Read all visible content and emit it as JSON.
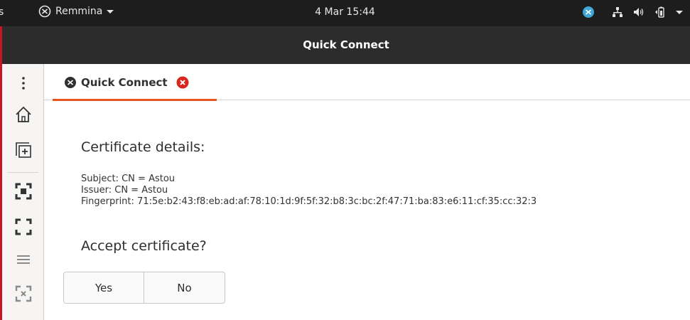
{
  "topbar": {
    "activities": "s",
    "app_name": "Remmina",
    "clock": "4 Mar  15:44",
    "tray_icons": [
      "remmina-tray-icon",
      "network-icon",
      "volume-icon",
      "battery-icon",
      "system-menu-icon"
    ]
  },
  "window": {
    "title": "Quick Connect"
  },
  "sidebar": {
    "items": [
      "menu-icon",
      "home-icon",
      "new-tab-icon",
      "screenshot-icon",
      "fullscreen-icon",
      "hamburger-icon",
      "scale-icon"
    ]
  },
  "tab": {
    "label": "Quick Connect"
  },
  "dialog": {
    "title": "Certificate details:",
    "subject": "Subject: CN = Astou",
    "issuer": "Issuer: CN = Astou",
    "fingerprint": "Fingerprint: 71:5e:b2:43:f8:eb:ad:af:78:10:1d:9f:5f:32:b8:3c:bc:2f:47:71:ba:83:e6:11:cf:35:cc:32:3",
    "question": "Accept certificate?",
    "yes": "Yes",
    "no": "No"
  },
  "colors": {
    "accent": "#e95420",
    "close_red": "#d8261e",
    "topbar_bg": "#1d1d1d",
    "titlebar_bg": "#2c2c2c",
    "tray_blue": "#3fa6d6"
  }
}
